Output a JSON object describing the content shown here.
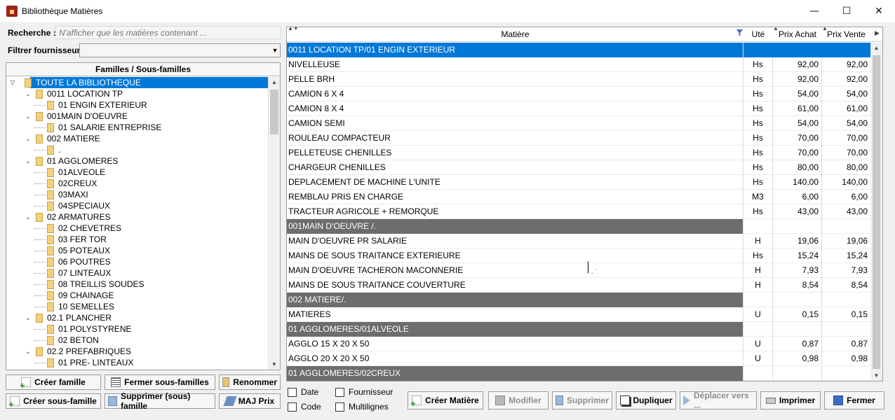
{
  "window": {
    "title": "Bibliothèque Matières",
    "controls": {
      "minimize": "—",
      "maximize": "☐",
      "close": "✕"
    }
  },
  "search": {
    "label": "Recherche :",
    "placeholder": "N'afficher que les matières contenant ...",
    "value": ""
  },
  "filter": {
    "label": "Filtrer fournisseur :",
    "value": ""
  },
  "tree": {
    "header": "Familles / Sous-familles",
    "nodes": [
      {
        "label": "TOUTE LA BIBLIOTHEQUE",
        "level": 0,
        "selected": true
      },
      {
        "label": "0011 LOCATION TP",
        "level": 1
      },
      {
        "label": "01 ENGIN EXTERIEUR",
        "level": 2
      },
      {
        "label": "001MAIN D'OEUVRE",
        "level": 1
      },
      {
        "label": "01 SALARIE ENTREPRISE",
        "level": 2
      },
      {
        "label": "002 MATIERE",
        "level": 1
      },
      {
        "label": ".",
        "level": 2
      },
      {
        "label": "01 AGGLOMERES",
        "level": 1
      },
      {
        "label": "01ALVEOLE",
        "level": 2
      },
      {
        "label": "02CREUX",
        "level": 2
      },
      {
        "label": "03MAXI",
        "level": 2
      },
      {
        "label": "04SPECIAUX",
        "level": 2
      },
      {
        "label": "02 ARMATURES",
        "level": 1
      },
      {
        "label": "02 CHEVETRES",
        "level": 2
      },
      {
        "label": "03 FER TOR",
        "level": 2
      },
      {
        "label": "05 POTEAUX",
        "level": 2
      },
      {
        "label": "06 POUTRES",
        "level": 2
      },
      {
        "label": "07 LINTEAUX",
        "level": 2
      },
      {
        "label": "08 TREILLIS SOUDES",
        "level": 2
      },
      {
        "label": "09 CHAINAGE",
        "level": 2
      },
      {
        "label": "10 SEMELLES",
        "level": 2
      },
      {
        "label": "02.1 PLANCHER",
        "level": 1
      },
      {
        "label": "01 POLYSTYRENE",
        "level": 2
      },
      {
        "label": "02 BETON",
        "level": 2
      },
      {
        "label": "02.2 PREFABRIQUES",
        "level": 1
      },
      {
        "label": "01 PRE- LINTEAUX",
        "level": 2
      }
    ]
  },
  "left_buttons": {
    "create_family": "Créer famille",
    "close_subfamilies": "Fermer sous-familles",
    "rename": "Renommer",
    "create_subfamily": "Créer sous-famille",
    "delete_family": "Supprimer (sous) famille",
    "update_price": "MAJ Prix"
  },
  "grid": {
    "columns": {
      "name": "Matière",
      "unit": "Uté",
      "buy": "Prix Achat",
      "sell": "Prix Vente"
    },
    "rows": [
      {
        "type": "category",
        "name": "0011 LOCATION TP/01 ENGIN EXTERIEUR",
        "unit": "",
        "buy": "",
        "sell": "",
        "selected": true
      },
      {
        "type": "item",
        "name": "NIVELLEUSE",
        "unit": "Hs",
        "buy": "92,00",
        "sell": "92,00"
      },
      {
        "type": "item",
        "name": "PELLE BRH",
        "unit": "Hs",
        "buy": "92,00",
        "sell": "92,00"
      },
      {
        "type": "item",
        "name": "CAMION 6 X 4",
        "unit": "Hs",
        "buy": "54,00",
        "sell": "54,00"
      },
      {
        "type": "item",
        "name": "CAMION 8 X 4",
        "unit": "Hs",
        "buy": "61,00",
        "sell": "61,00"
      },
      {
        "type": "item",
        "name": "CAMION SEMI",
        "unit": "Hs",
        "buy": "54,00",
        "sell": "54,00"
      },
      {
        "type": "item",
        "name": "ROULEAU COMPACTEUR",
        "unit": "Hs",
        "buy": "70,00",
        "sell": "70,00"
      },
      {
        "type": "item",
        "name": "PELLETEUSE CHENILLES",
        "unit": "Hs",
        "buy": "70,00",
        "sell": "70,00"
      },
      {
        "type": "item",
        "name": "CHARGEUR CHENILLES",
        "unit": "Hs",
        "buy": "80,00",
        "sell": "80,00"
      },
      {
        "type": "item",
        "name": "DEPLACEMENT DE MACHINE L'UNITE",
        "unit": "Hs",
        "buy": "140,00",
        "sell": "140,00"
      },
      {
        "type": "item",
        "name": "REMBLAU PRIS EN CHARGE",
        "unit": "M3",
        "buy": "6,00",
        "sell": "6,00"
      },
      {
        "type": "item",
        "name": "TRACTEUR AGRICOLE + REMORQUE",
        "unit": "Hs",
        "buy": "43,00",
        "sell": "43,00"
      },
      {
        "type": "category",
        "name": "001MAIN D'OEUVRE /.",
        "unit": "",
        "buy": "",
        "sell": ""
      },
      {
        "type": "item",
        "name": "MAIN D'OEUVRE PR SALARIE",
        "unit": "H",
        "buy": "19,06",
        "sell": "19,06"
      },
      {
        "type": "item",
        "name": "MAINS DE SOUS TRAITANCE EXTERIEURE",
        "unit": "Hs",
        "buy": "15,24",
        "sell": "15,24"
      },
      {
        "type": "item",
        "name": "MAIN D'OEUVRE TACHERON MACONNERIE",
        "unit": "H",
        "buy": "7,93",
        "sell": "7,93"
      },
      {
        "type": "item",
        "name": "MAINS DE SOUS TRAITANCE COUVERTURE",
        "unit": "H",
        "buy": "8,54",
        "sell": "8,54"
      },
      {
        "type": "category",
        "name": "002 MATIERE/.",
        "unit": "",
        "buy": "",
        "sell": ""
      },
      {
        "type": "item",
        "name": "MATIERES",
        "unit": "U",
        "buy": "0,15",
        "sell": "0,15"
      },
      {
        "type": "category",
        "name": "01 AGGLOMERES/01ALVEOLE",
        "unit": "",
        "buy": "",
        "sell": ""
      },
      {
        "type": "item",
        "name": "AGGLO 15 X 20 X 50",
        "unit": "U",
        "buy": "0,87",
        "sell": "0,87"
      },
      {
        "type": "item",
        "name": "AGGLO 20 X 20 X 50",
        "unit": "U",
        "buy": "0,98",
        "sell": "0,98"
      },
      {
        "type": "category",
        "name": "01 AGGLOMERES/02CREUX",
        "unit": "",
        "buy": "",
        "sell": ""
      }
    ]
  },
  "options": {
    "date": "Date",
    "supplier": "Fournisseur",
    "code": "Code",
    "multiline": "Multilignes"
  },
  "right_buttons": {
    "create_item": "Créer Matière",
    "modify": "Modifier",
    "delete": "Supprimer",
    "duplicate": "Dupliquer",
    "move_to": "Déplacer vers ...",
    "print": "Imprimer",
    "close": "Fermer"
  }
}
